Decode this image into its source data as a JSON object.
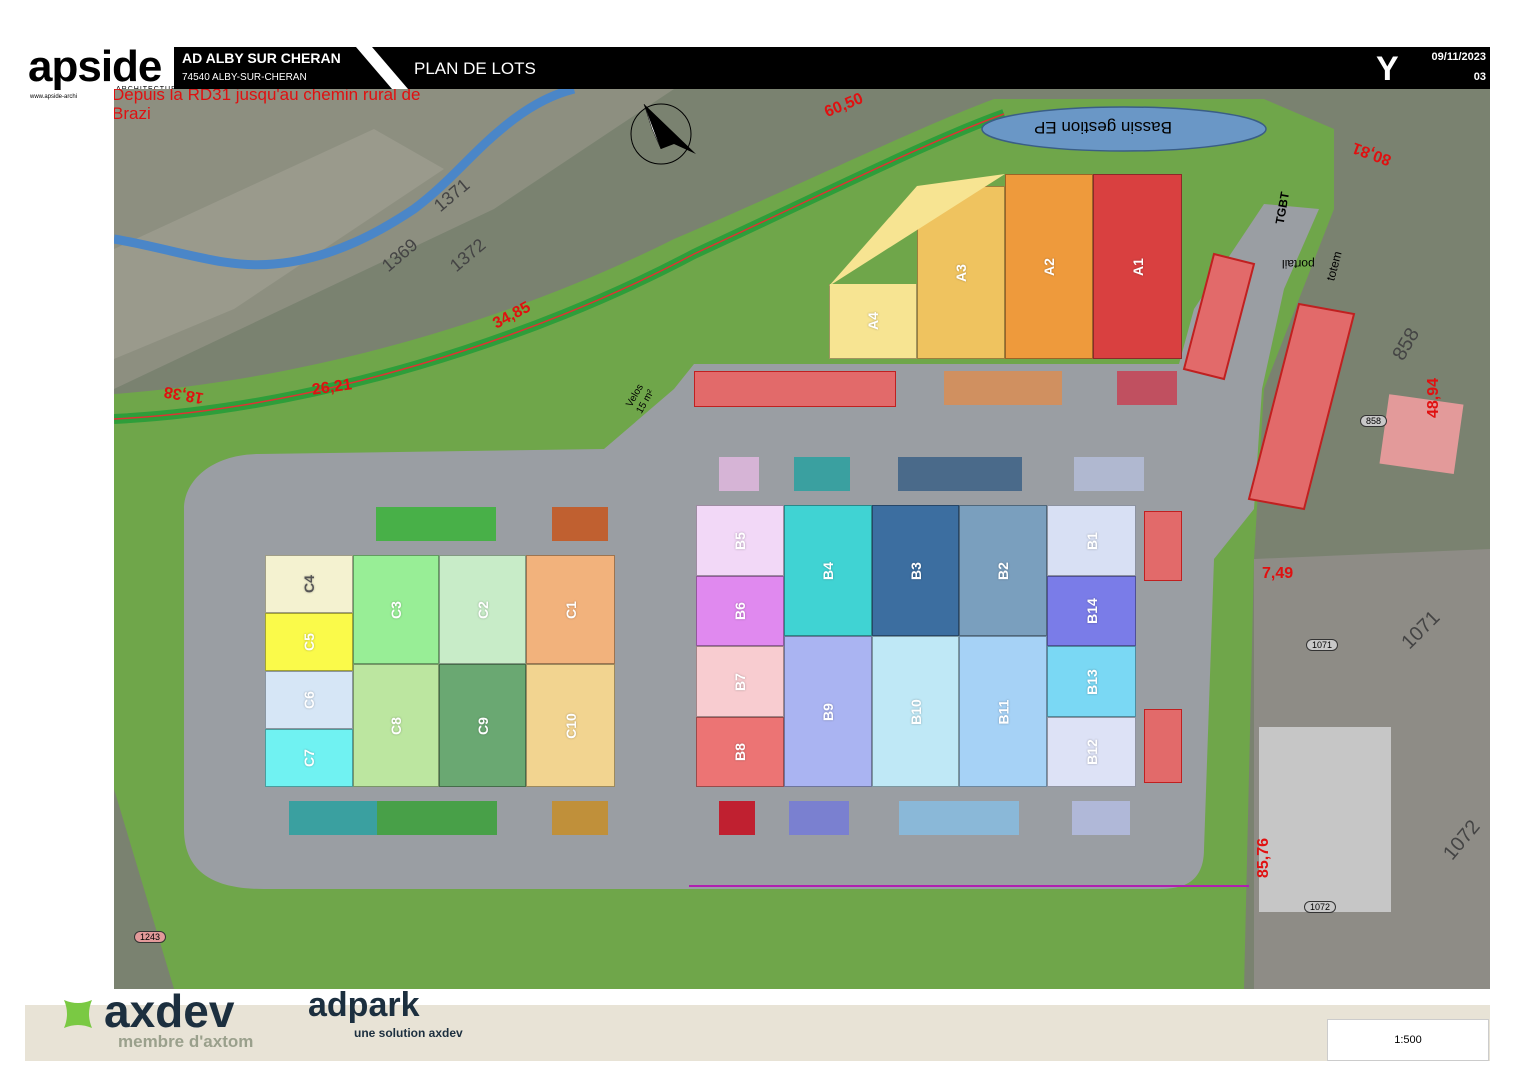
{
  "header": {
    "logo_text": "apside",
    "logo_sub": "ARCHITECTURE",
    "logo_web": "www.apside-archi",
    "project": "AD ALBY SUR CHERAN",
    "city": "74540 ALBY-SUR-CHERAN",
    "plan_title": "PLAN DE LOTS",
    "y_mark": "Y",
    "date": "09/11/2023",
    "sheet": "03"
  },
  "map": {
    "lots_a": [
      {
        "id": "A4",
        "color": "#f7e492"
      },
      {
        "id": "A3",
        "color": "#efc35f"
      },
      {
        "id": "A2",
        "color": "#ee9a3c"
      },
      {
        "id": "A1",
        "color": "#d94040"
      }
    ],
    "lots_b": [
      {
        "id": "B5",
        "color": "#f2d8f7"
      },
      {
        "id": "B4",
        "color": "#40d3d3"
      },
      {
        "id": "B3",
        "color": "#3c6ea0"
      },
      {
        "id": "B2",
        "color": "#7a9fbe"
      },
      {
        "id": "B1",
        "color": "#d8e0f4"
      },
      {
        "id": "B6",
        "color": "#e089ef"
      },
      {
        "id": "B14",
        "color": "#7a7ce8"
      },
      {
        "id": "B7",
        "color": "#f8ccd0"
      },
      {
        "id": "B9",
        "color": "#aab4f2"
      },
      {
        "id": "B10",
        "color": "#bfe8f6"
      },
      {
        "id": "B11",
        "color": "#a6d2f6"
      },
      {
        "id": "B13",
        "color": "#7ad8f4"
      },
      {
        "id": "B8",
        "color": "#ec7474"
      },
      {
        "id": "B12",
        "color": "#dde2f6"
      }
    ],
    "lots_c": [
      {
        "id": "C4",
        "color": "#f4f2d0"
      },
      {
        "id": "C3",
        "color": "#98ee96"
      },
      {
        "id": "C2",
        "color": "#c8ecc8"
      },
      {
        "id": "C1",
        "color": "#f2b27c"
      },
      {
        "id": "C5",
        "color": "#fafa4a"
      },
      {
        "id": "C6",
        "color": "#d6e6f6"
      },
      {
        "id": "C8",
        "color": "#bce6a0"
      },
      {
        "id": "C9",
        "color": "#6aa872"
      },
      {
        "id": "C10",
        "color": "#f2d490"
      },
      {
        "id": "C7",
        "color": "#70f2f2"
      }
    ],
    "basin_label": "Bassin gestion EP",
    "velos_label": "Velos",
    "velos_area": "15 m²",
    "portail_label": "portail",
    "totem_label": "totem",
    "tgbt_label": "TGBT",
    "dims": [
      "60,50",
      "34,85",
      "26,21",
      "18,38",
      "80,81",
      "48,94",
      "7,49",
      "85,76"
    ],
    "road_text": [
      "Depuis la RD31 jusqu'au chemin rural de",
      "Brazi"
    ],
    "parcels": [
      "1371",
      "1369",
      "1372",
      "858",
      "1071",
      "1072",
      "1243"
    ],
    "parcel_tags": [
      "858",
      "1071",
      "1072",
      "1243"
    ]
  },
  "footer": {
    "axdev_word": "axdev",
    "axdev_member": "membre d'axtom",
    "adpark_word": "adpark",
    "adpark_sub": "une solution axdev",
    "scale": "1:500"
  },
  "colors": {
    "header_bg": "#000000",
    "road": "#9a9ea3",
    "grass": "#6fa64a",
    "dim_red": "#e01010",
    "basin": "#6a97c6"
  }
}
